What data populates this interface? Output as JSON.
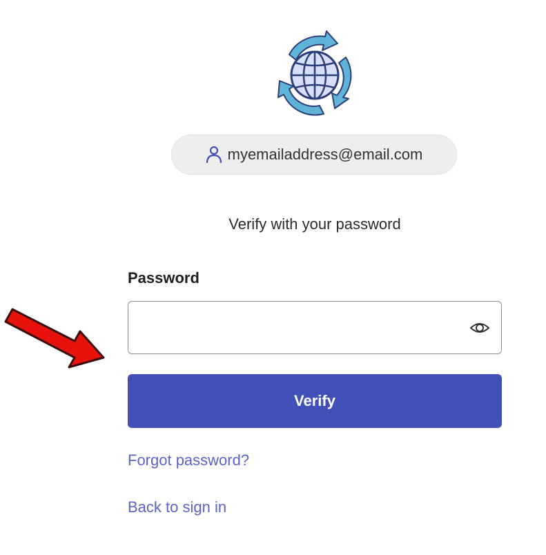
{
  "logo": {
    "icon": "globe-sync-icon",
    "colors": {
      "ring": "#5fb3d6",
      "globe_fill": "#d9defa",
      "outline": "#2c3e77"
    }
  },
  "identity": {
    "icon": "user-icon",
    "email": "myemailaddress@email.com"
  },
  "subtitle": "Verify with your password",
  "password": {
    "label": "Password",
    "value": "",
    "placeholder": "",
    "toggle_icon": "eye-icon"
  },
  "actions": {
    "verify_label": "Verify",
    "forgot_label": "Forgot password?",
    "back_label": "Back to sign in"
  },
  "annotation": {
    "icon": "red-arrow-icon",
    "color": "#e8120c"
  },
  "colors": {
    "primary": "#4050b6",
    "link": "#5b63c4",
    "pill_bg": "#eeeeee"
  }
}
